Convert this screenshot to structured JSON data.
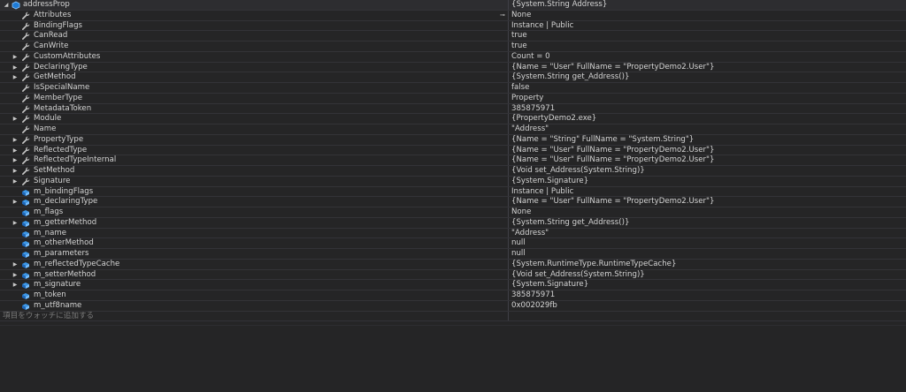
{
  "root": {
    "name": "addressProp",
    "value": "{System.String Address}",
    "icon": "object-icon"
  },
  "rows": [
    {
      "name": "Attributes",
      "value": "None",
      "expandable": false,
      "kind": "property",
      "pin": true
    },
    {
      "name": "BindingFlags",
      "value": "Instance | Public",
      "expandable": false,
      "kind": "property"
    },
    {
      "name": "CanRead",
      "value": "true",
      "expandable": false,
      "kind": "property"
    },
    {
      "name": "CanWrite",
      "value": "true",
      "expandable": false,
      "kind": "property"
    },
    {
      "name": "CustomAttributes",
      "value": "Count = 0",
      "expandable": true,
      "kind": "property"
    },
    {
      "name": "DeclaringType",
      "value": "{Name = \"User\" FullName = \"PropertyDemo2.User\"}",
      "expandable": true,
      "kind": "property"
    },
    {
      "name": "GetMethod",
      "value": "{System.String get_Address()}",
      "expandable": true,
      "kind": "property"
    },
    {
      "name": "IsSpecialName",
      "value": "false",
      "expandable": false,
      "kind": "property"
    },
    {
      "name": "MemberType",
      "value": "Property",
      "expandable": false,
      "kind": "property"
    },
    {
      "name": "MetadataToken",
      "value": "385875971",
      "expandable": false,
      "kind": "property"
    },
    {
      "name": "Module",
      "value": "{PropertyDemo2.exe}",
      "expandable": true,
      "kind": "property"
    },
    {
      "name": "Name",
      "value": "\"Address\"",
      "expandable": false,
      "kind": "property"
    },
    {
      "name": "PropertyType",
      "value": "{Name = \"String\" FullName = \"System.String\"}",
      "expandable": true,
      "kind": "property"
    },
    {
      "name": "ReflectedType",
      "value": "{Name = \"User\" FullName = \"PropertyDemo2.User\"}",
      "expandable": true,
      "kind": "property"
    },
    {
      "name": "ReflectedTypeInternal",
      "value": "{Name = \"User\" FullName = \"PropertyDemo2.User\"}",
      "expandable": true,
      "kind": "property"
    },
    {
      "name": "SetMethod",
      "value": "{Void set_Address(System.String)}",
      "expandable": true,
      "kind": "property"
    },
    {
      "name": "Signature",
      "value": "{System.Signature}",
      "expandable": true,
      "kind": "property"
    },
    {
      "name": "m_bindingFlags",
      "value": "Instance | Public",
      "expandable": false,
      "kind": "field"
    },
    {
      "name": "m_declaringType",
      "value": "{Name = \"User\" FullName = \"PropertyDemo2.User\"}",
      "expandable": true,
      "kind": "field"
    },
    {
      "name": "m_flags",
      "value": "None",
      "expandable": false,
      "kind": "field"
    },
    {
      "name": "m_getterMethod",
      "value": "{System.String get_Address()}",
      "expandable": true,
      "kind": "field"
    },
    {
      "name": "m_name",
      "value": "\"Address\"",
      "expandable": false,
      "kind": "field"
    },
    {
      "name": "m_otherMethod",
      "value": "null",
      "expandable": false,
      "kind": "field"
    },
    {
      "name": "m_parameters",
      "value": "null",
      "expandable": false,
      "kind": "field"
    },
    {
      "name": "m_reflectedTypeCache",
      "value": "{System.RuntimeType.RuntimeTypeCache}",
      "expandable": true,
      "kind": "field"
    },
    {
      "name": "m_setterMethod",
      "value": "{Void set_Address(System.String)}",
      "expandable": true,
      "kind": "field"
    },
    {
      "name": "m_signature",
      "value": "{System.Signature}",
      "expandable": true,
      "kind": "field"
    },
    {
      "name": "m_token",
      "value": "385875971",
      "expandable": false,
      "kind": "field"
    },
    {
      "name": "m_utf8name",
      "value": "0x002029fb",
      "expandable": false,
      "kind": "field"
    }
  ],
  "add_watch_placeholder": "項目をウォッチに追加する",
  "colors": {
    "background": "#252526",
    "text": "#d4d4d4",
    "grid": "#333337",
    "property_icon": "#c8c8c8",
    "field_icon": "#75beff"
  }
}
